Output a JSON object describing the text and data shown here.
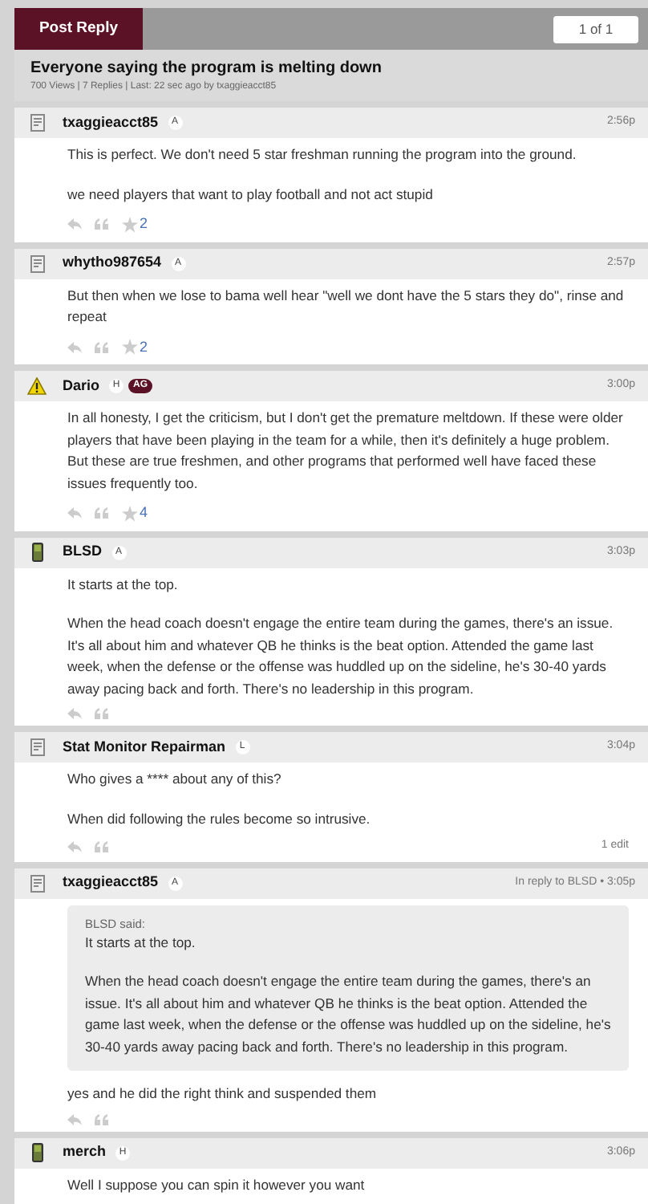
{
  "toolbar": {
    "post_reply": "Post Reply",
    "pagination": "1 of 1"
  },
  "thread": {
    "title": "Everyone saying the program is melting down",
    "meta": "700 Views | 7 Replies | Last: 22 sec ago by txaggieacct85"
  },
  "posts": [
    {
      "user": "txaggieacct85",
      "kind": "desktop",
      "badges": [
        {
          "kind": "letter",
          "text": "A"
        }
      ],
      "time": "2:56p",
      "paragraphs": [
        "This is perfect. We don't need 5 star freshman running the program into the ground.",
        "we need players that want to play football and not act stupid"
      ],
      "stars": "2"
    },
    {
      "user": "whytho987654",
      "kind": "desktop",
      "badges": [
        {
          "kind": "letter",
          "text": "A"
        }
      ],
      "time": "2:57p",
      "paragraphs": [
        "But then when we lose to bama well hear \"well we dont have the 5 stars they do\", rinse and repeat"
      ],
      "stars": "2"
    },
    {
      "user": "Dario",
      "kind": "warning",
      "badges": [
        {
          "kind": "letter",
          "text": "H"
        },
        {
          "kind": "tag",
          "text": "AG"
        }
      ],
      "time": "3:00p",
      "paragraphs": [
        "In all honesty, I get the criticism, but I don't get the premature meltdown. If these were older players that have been playing in the team for a while, then it's definitely a huge problem. But these are true freshmen, and other programs that performed well have faced these issues frequently too."
      ],
      "stars": "4"
    },
    {
      "user": "BLSD",
      "kind": "mobile",
      "badges": [
        {
          "kind": "letter",
          "text": "A"
        }
      ],
      "time": "3:03p",
      "paragraphs": [
        "It starts at the top.",
        "When the head coach doesn't engage the entire team during the games, there's an issue. It's all about him and whatever QB he thinks is the beat option. Attended the game last week, when the defense or the offense was huddled up on the sideline, he's 30-40 yards away pacing back and forth. There's no leadership in this program."
      ]
    },
    {
      "user": "Stat Monitor Repairman",
      "kind": "desktop",
      "badges": [
        {
          "kind": "letter",
          "text": "L"
        }
      ],
      "time": "3:04p",
      "paragraphs": [
        "Who gives a **** about any of this?",
        "When did following the rules become so intrusive."
      ],
      "edit": "1 edit"
    },
    {
      "user": "txaggieacct85",
      "kind": "desktop",
      "badges": [
        {
          "kind": "letter",
          "text": "A"
        }
      ],
      "time": "In reply to BLSD • 3:05p",
      "quote": {
        "author": "BLSD said:",
        "paragraphs": [
          "It starts at the top.",
          "When the head coach doesn't engage the entire team during the games, there's an issue. It's all about him and whatever QB he thinks is the beat option. Attended the game last week, when the defense or the offense was huddled up on the sideline, he's 30-40 yards away pacing back and forth. There's no leadership in this program."
        ]
      },
      "paragraphs": [
        "yes and he did the right think and suspended them"
      ]
    },
    {
      "user": "merch",
      "kind": "mobile",
      "badges": [
        {
          "kind": "letter",
          "text": "H"
        }
      ],
      "time": "3:06p",
      "paragraphs": [
        "Well I suppose you can spin it however you want"
      ]
    }
  ]
}
